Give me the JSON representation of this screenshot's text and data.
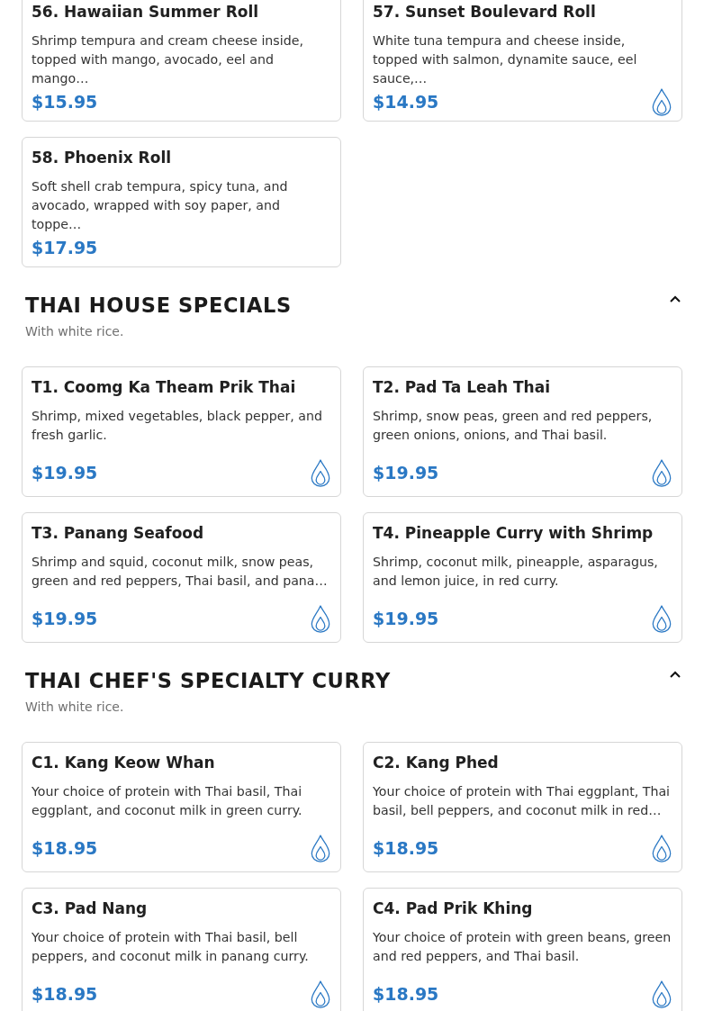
{
  "sections": [
    {
      "items": [
        {
          "name": "56. Hawaiian Summer Roll",
          "description": "Shrimp tempura and cream cheese inside, topped with mango, avocado, eel and mango…",
          "price": "$15.95",
          "spicy": false
        },
        {
          "name": "57. Sunset Boulevard Roll",
          "description": "White tuna tempura and cheese inside, topped with salmon, dynamite sauce, eel sauce,…",
          "price": "$14.95",
          "spicy": true
        },
        {
          "name": "58. Phoenix Roll",
          "description": "Soft shell crab tempura, spicy tuna, and avocado, wrapped with soy paper, and toppe…",
          "price": "$17.95",
          "spicy": false
        }
      ]
    },
    {
      "title": "THAI HOUSE SPECIALS",
      "subtitle": "With white rice.",
      "expanded": true,
      "items": [
        {
          "name": "T1. Coomg Ka Theam Prik Thai",
          "description": "Shrimp, mixed vegetables, black pepper, and fresh garlic.",
          "price": "$19.95",
          "spicy": true
        },
        {
          "name": "T2. Pad Ta Leah Thai",
          "description": "Shrimp, snow peas, green and red peppers, green onions, onions, and Thai basil.",
          "price": "$19.95",
          "spicy": true
        },
        {
          "name": "T3. Panang Seafood",
          "description": "Shrimp and squid, coconut milk, snow peas, green and red peppers, Thai basil, and pana…",
          "price": "$19.95",
          "spicy": true
        },
        {
          "name": "T4. Pineapple Curry with Shrimp",
          "description": "Shrimp, coconut milk, pineapple, asparagus, and lemon juice, in red curry.",
          "price": "$19.95",
          "spicy": true
        }
      ]
    },
    {
      "title": "THAI CHEF'S SPECIALTY CURRY",
      "subtitle": "With white rice.",
      "expanded": true,
      "items": [
        {
          "name": "C1. Kang Keow Whan",
          "description": "Your choice of protein with Thai basil, Thai eggplant, and coconut milk in green curry.",
          "price": "$18.95",
          "spicy": true
        },
        {
          "name": "C2. Kang Phed",
          "description": "Your choice of protein with Thai eggplant, Thai basil, bell peppers, and coconut milk in red…",
          "price": "$18.95",
          "spicy": true
        },
        {
          "name": "C3. Pad Nang",
          "description": "Your choice of protein with Thai basil, bell peppers, and coconut milk in panang curry.",
          "price": "$18.95",
          "spicy": true
        },
        {
          "name": "C4. Pad Prik Khing",
          "description": "Your choice of protein with green beans, green and red peppers, and Thai basil.",
          "price": "$18.95",
          "spicy": true
        }
      ]
    }
  ]
}
